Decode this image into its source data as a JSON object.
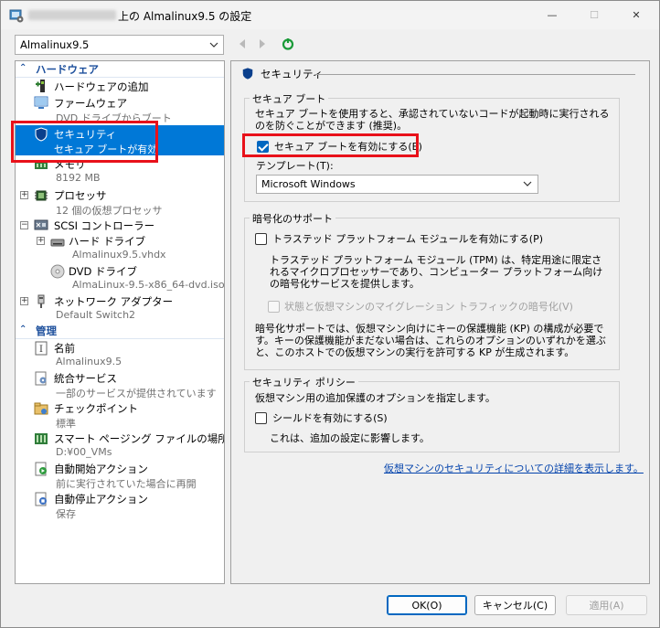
{
  "window": {
    "title": "上の Almalinux9.5 の設定",
    "controls": {
      "minimize": "—",
      "maximize": "☐",
      "close": "✕"
    }
  },
  "vm_selector": {
    "value": "Almalinux9.5"
  },
  "nav": {
    "back": "back-icon",
    "forward": "forward-icon",
    "refresh": "refresh-icon"
  },
  "sidebar": {
    "hardware_section": "ハードウェア",
    "manage_section": "管理",
    "items": {
      "add_hw": {
        "label": "ハードウェアの追加"
      },
      "firmware": {
        "label": "ファームウェア",
        "sub": "DVD ドライブからブート"
      },
      "security": {
        "label": "セキュリティ",
        "sub": "セキュア ブートが有効"
      },
      "memory": {
        "label": "メモリ",
        "sub": "8192 MB"
      },
      "processor": {
        "label": "プロセッサ",
        "sub": "12 個の仮想プロセッサ"
      },
      "scsi": {
        "label": "SCSI コントローラー"
      },
      "hdd": {
        "label": "ハード ドライブ",
        "sub": "Almalinux9.5.vhdx"
      },
      "dvd": {
        "label": "DVD ドライブ",
        "sub": "AlmaLinux-9.5-x86_64-dvd.iso"
      },
      "network": {
        "label": "ネットワーク アダプター",
        "sub": "Default Switch2"
      },
      "name": {
        "label": "名前",
        "sub": "Almalinux9.5"
      },
      "integration": {
        "label": "統合サービス",
        "sub": "一部のサービスが提供されています"
      },
      "checkpoint": {
        "label": "チェックポイント",
        "sub": "標準"
      },
      "paging": {
        "label": "スマート ページング ファイルの場所",
        "sub": "D:¥00_VMs"
      },
      "autostart": {
        "label": "自動開始アクション",
        "sub": "前に実行されていた場合に再開"
      },
      "autostop": {
        "label": "自動停止アクション",
        "sub": "保存"
      }
    }
  },
  "panel": {
    "header": "セキュリティ",
    "secure_boot": {
      "group_title": "セキュア ブート",
      "desc": "セキュア ブートを使用すると、承認されていないコードが起動時に実行されるのを防ぐことができます (推奨)。",
      "checkbox_label": "セキュア ブートを有効にする(E)",
      "checked": true,
      "template_label": "テンプレート(T):",
      "template_value": "Microsoft Windows"
    },
    "encryption": {
      "group_title": "暗号化のサポート",
      "tpm_label": "トラステッド プラットフォーム モジュールを有効にする(P)",
      "tpm_desc": "トラステッド プラットフォーム モジュール (TPM) は、特定用途に限定されるマイクロプロセッサーであり、コンピューター プラットフォーム向けの暗号化サービスを提供します。",
      "traffic_label": "状態と仮想マシンのマイグレーション トラフィックの暗号化(V)",
      "kp_desc": "暗号化サポートでは、仮想マシン向けにキーの保護機能 (KP) の構成が必要です。キーの保護機能がまだない場合は、これらのオプションのいずれかを選ぶと、このホストでの仮想マシンの実行を許可する KP が生成されます。"
    },
    "policy": {
      "group_title": "セキュリティ ポリシー",
      "desc": "仮想マシン用の追加保護のオプションを指定します。",
      "shield_label": "シールドを有効にする(S)",
      "shield_note": "これは、追加の設定に影響します。"
    },
    "link": "仮想マシンのセキュリティについての詳細を表示します。"
  },
  "buttons": {
    "ok": "OK(O)",
    "cancel": "キャンセル(C)",
    "apply": "適用(A)"
  },
  "colors": {
    "selection": "#0078d7",
    "highlight_box": "#e8111a",
    "link": "#0645ad"
  }
}
